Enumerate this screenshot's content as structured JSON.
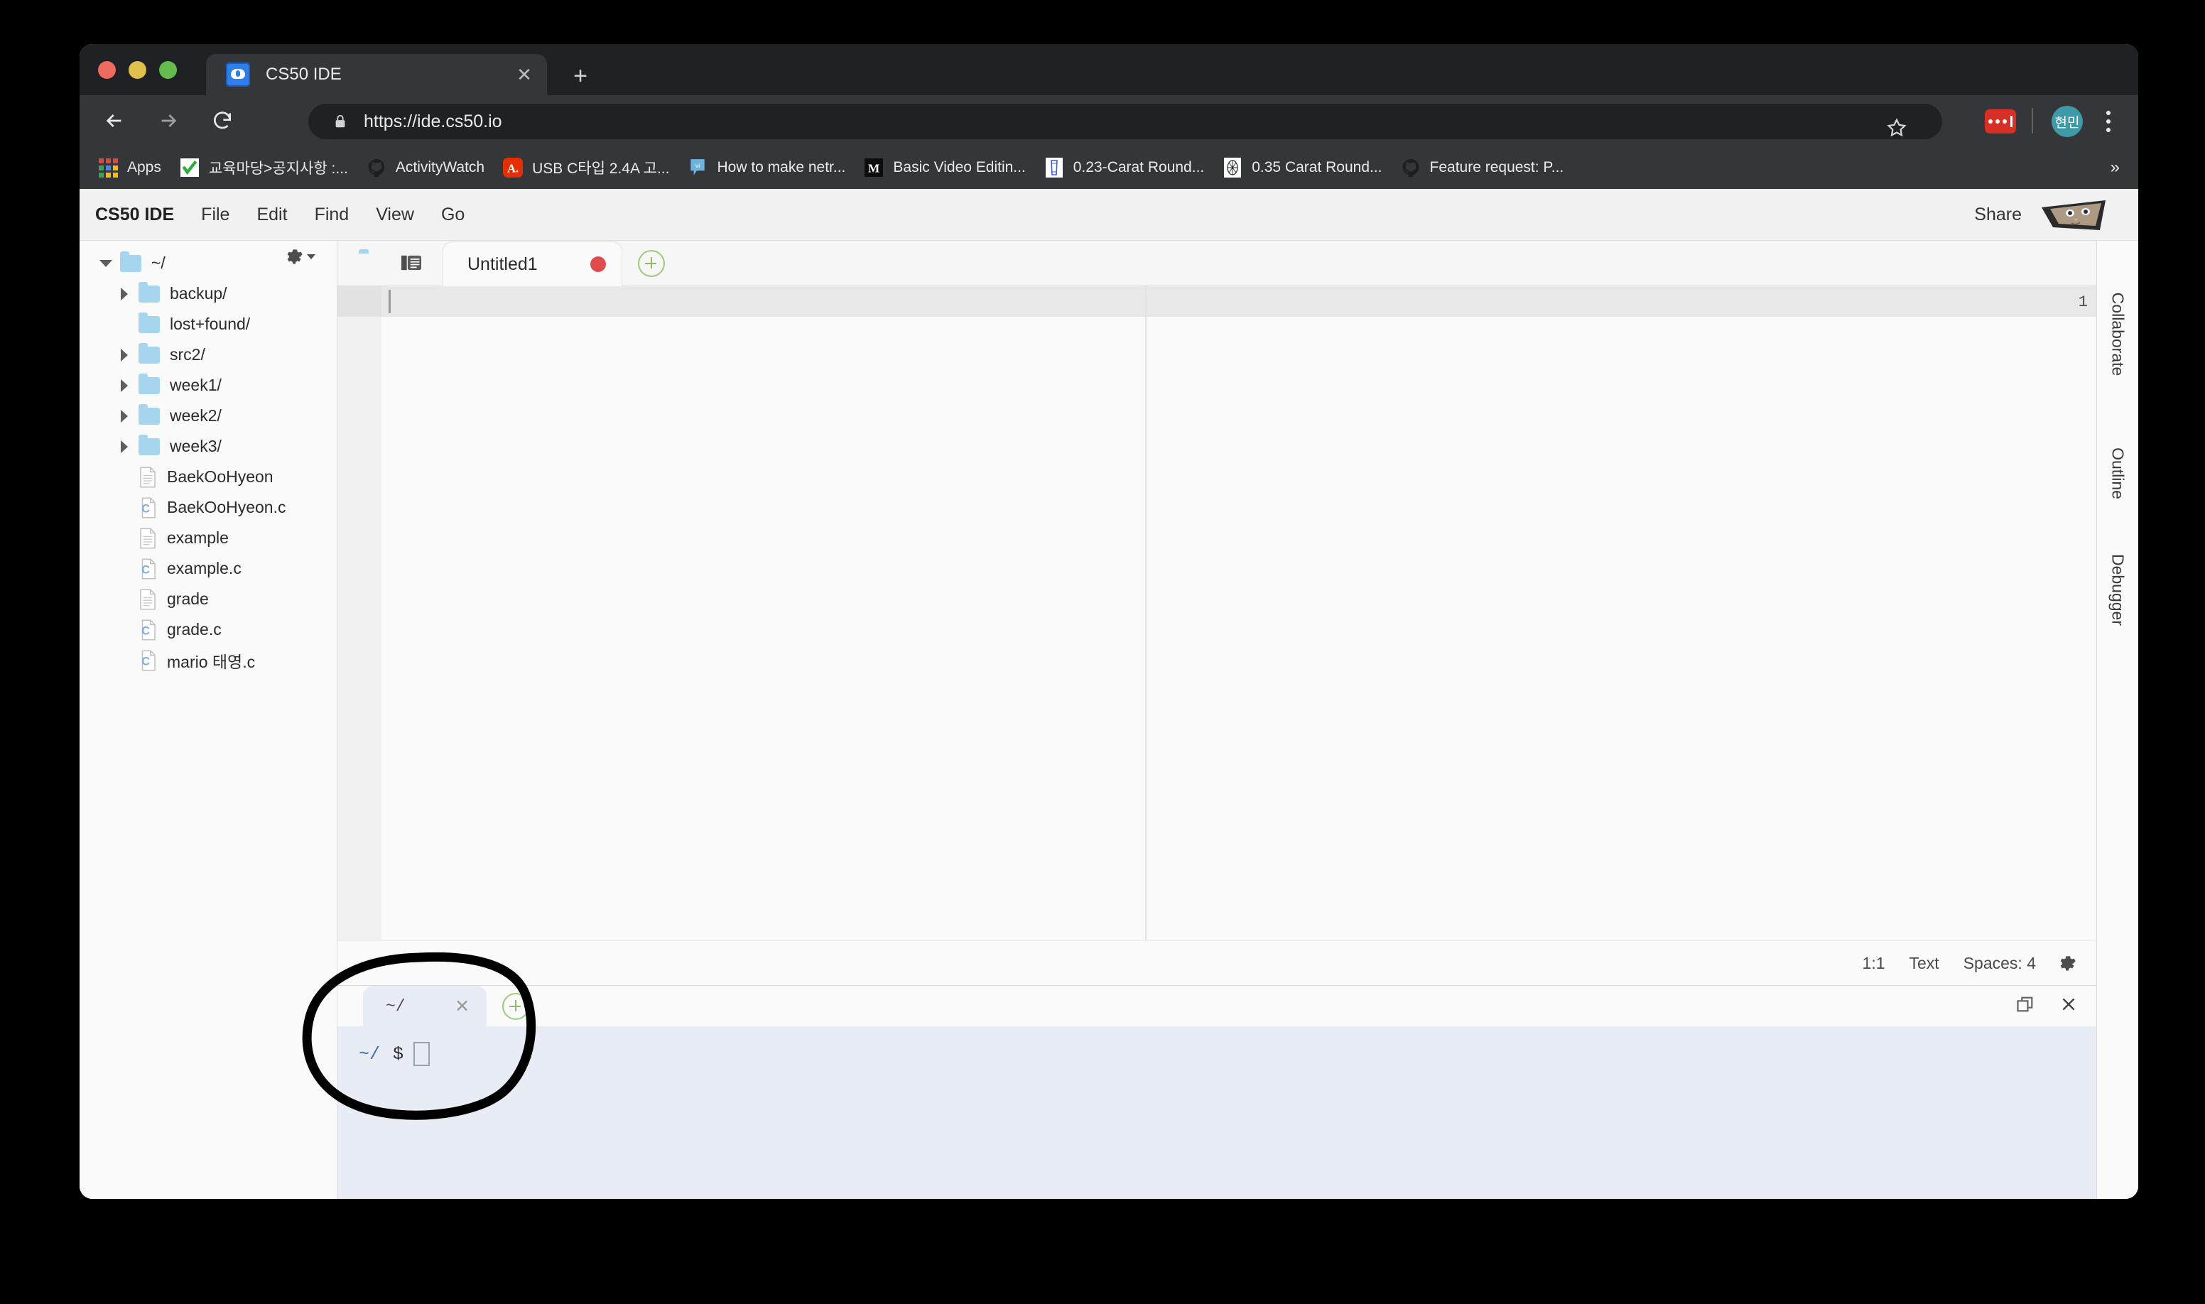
{
  "browser": {
    "tab": {
      "title": "CS50 IDE",
      "favicon": "cs50-favicon",
      "close_icon": "close-icon"
    },
    "new_tab_label": "+",
    "nav": {
      "back_icon": "back-arrow-icon",
      "forward_icon": "forward-arrow-icon",
      "reload_icon": "reload-icon"
    },
    "omnibox": {
      "url": "https://ide.cs50.io",
      "lock_icon": "lock-icon",
      "star_icon": "star-icon"
    },
    "extension_icon": "extension-icon",
    "profile_initials": "현민",
    "menu_icon": "kebab-menu-icon",
    "bookmarks": [
      {
        "label": "Apps",
        "icon": "apps-grid-icon"
      },
      {
        "label": "교육마당>공지사항 :...",
        "icon": "checkmark-icon"
      },
      {
        "label": "ActivityWatch",
        "icon": "github-icon"
      },
      {
        "label": "USB C타입 2.4A 고...",
        "icon": "aliexpress-icon"
      },
      {
        "label": "How to make netr...",
        "icon": "vimeo-icon"
      },
      {
        "label": "Basic Video Editin...",
        "icon": "medium-icon"
      },
      {
        "label": "0.23-Carat Round...",
        "icon": "diamond-icon"
      },
      {
        "label": "0.35 Carat Round...",
        "icon": "gem-icon"
      },
      {
        "label": "Feature request: P...",
        "icon": "github-icon"
      }
    ],
    "bookmarks_overflow": "»"
  },
  "ide": {
    "brand": "CS50 IDE",
    "menu": [
      "File",
      "Edit",
      "Find",
      "View",
      "Go"
    ],
    "share_label": "Share",
    "avatar": "cat-avatar",
    "filetree": {
      "gear_icon": "gear-icon",
      "items": [
        {
          "label": "~/",
          "type": "folder",
          "state": "expanded",
          "depth": 0
        },
        {
          "label": "backup/",
          "type": "folder",
          "state": "collapsed",
          "depth": 1
        },
        {
          "label": "lost+found/",
          "type": "folder",
          "state": "leaf",
          "depth": 1
        },
        {
          "label": "src2/",
          "type": "folder",
          "state": "collapsed",
          "depth": 1
        },
        {
          "label": "week1/",
          "type": "folder",
          "state": "collapsed",
          "depth": 1
        },
        {
          "label": "week2/",
          "type": "folder",
          "state": "collapsed",
          "depth": 1
        },
        {
          "label": "week3/",
          "type": "folder",
          "state": "collapsed",
          "depth": 1
        },
        {
          "label": "BaekOoHyeon",
          "type": "file",
          "depth": 1
        },
        {
          "label": "BaekOoHyeon.c",
          "type": "cfile",
          "depth": 1
        },
        {
          "label": "example",
          "type": "file",
          "depth": 1
        },
        {
          "label": "example.c",
          "type": "cfile",
          "depth": 1
        },
        {
          "label": "grade",
          "type": "file",
          "depth": 1
        },
        {
          "label": "grade.c",
          "type": "cfile",
          "depth": 1
        },
        {
          "label": "mario 태영.c",
          "type": "cfile",
          "depth": 1
        }
      ]
    },
    "editor": {
      "toolbar_icons": [
        "folder-icon",
        "file-list-icon"
      ],
      "tab_name": "Untitled1",
      "dirty_indicator": "unsaved-dot",
      "new_tab_icon": "plus-circle-icon",
      "line_number": "1",
      "content": ""
    },
    "status": {
      "cursor": "1:1",
      "mode": "Text",
      "indent": "Spaces: 4",
      "gear_icon": "gear-icon"
    },
    "terminal": {
      "tab_name": "~/",
      "tab_close_icon": "close-icon",
      "new_tab_icon": "plus-circle-icon",
      "maximize_icon": "restore-window-icon",
      "close_icon": "close-icon",
      "prompt_path": "~/",
      "prompt_symbol": "$",
      "cursor": "block-cursor"
    },
    "rail": [
      "Collaborate",
      "Outline",
      "Debugger"
    ],
    "annotation": {
      "shape": "hand-drawn-circle",
      "color": "#000000"
    }
  },
  "colors": {
    "browser_chrome": "#35363a",
    "tabstrip": "#202124",
    "ide_bg": "#fafafa",
    "terminal_bg": "#e8ecf5",
    "folder_blue": "#a6d6ef",
    "accent_green": "#9ec97f",
    "dirty_red": "#e04b4b",
    "avatar_teal": "#3e9aa6"
  }
}
